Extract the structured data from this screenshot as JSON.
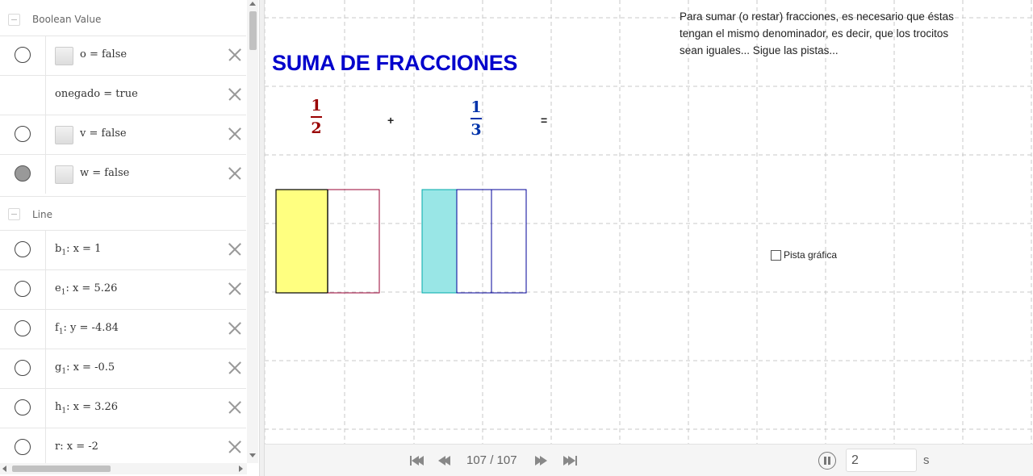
{
  "algebra": {
    "groups": [
      {
        "label": "Boolean Value",
        "rows": [
          {
            "text": "o = false",
            "checkbox": true,
            "marble": "off"
          },
          {
            "text": "onegado = true",
            "checkbox": false,
            "marble": "none"
          },
          {
            "text": "v = false",
            "checkbox": true,
            "marble": "off"
          },
          {
            "text": "w = false",
            "checkbox": true,
            "marble": "on"
          }
        ]
      },
      {
        "label": "Line",
        "rows": [
          {
            "name": "b",
            "sub": "1",
            "expr": ": x = 1",
            "marble": "off"
          },
          {
            "name": "e",
            "sub": "1",
            "expr": ": x = 5.26",
            "marble": "off"
          },
          {
            "name": "f",
            "sub": "1",
            "expr": ": y = -4.84",
            "marble": "off"
          },
          {
            "name": "g",
            "sub": "1",
            "expr": ": x = -0.5",
            "marble": "off"
          },
          {
            "name": "h",
            "sub": "1",
            "expr": ": x = 3.26",
            "marble": "off"
          },
          {
            "name": "r",
            "sub": "",
            "expr": ": x = -2",
            "marble": "off"
          }
        ]
      }
    ]
  },
  "graphics": {
    "title": "SUMA DE FRACCIONES",
    "instructions": "Para sumar (o restar) fracciones, es necesario que éstas tengan el mismo denominador, es decir, que los trocitos sean iguales... Sigue las pistas...",
    "fraction1": {
      "numerator": "1",
      "denominator": "2",
      "color": "#990000"
    },
    "plus": "+",
    "fraction2": {
      "numerator": "1",
      "denominator": "3",
      "color": "#0033aa"
    },
    "equals": "=",
    "hint_label": "Pista gráfica",
    "colors": {
      "half_fill": "#ffff80",
      "third_fill": "#99e6e6",
      "half_border": "#990033",
      "third_border": "#000099"
    }
  },
  "toolbar": {
    "step_display": "107 / 107",
    "speed_value": "2",
    "speed_unit": "s",
    "icons": [
      "first-step-icon",
      "previous-step-icon",
      "next-step-icon",
      "last-step-icon",
      "pause-icon"
    ]
  }
}
